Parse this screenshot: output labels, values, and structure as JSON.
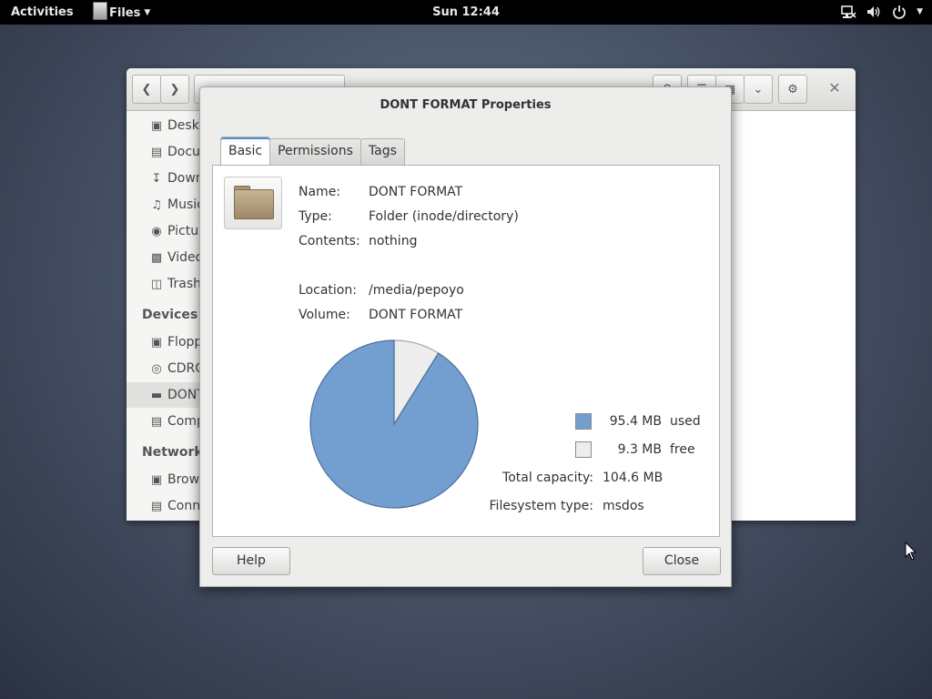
{
  "topbar": {
    "activities": "Activities",
    "app_name": "Files",
    "clock": "Sun 12:44"
  },
  "files_window": {
    "sidebar": {
      "items": [
        {
          "label": "Deskt",
          "icon": "folder-icon"
        },
        {
          "label": "Docu",
          "icon": "document-icon"
        },
        {
          "label": "Down",
          "icon": "download-icon"
        },
        {
          "label": "Music",
          "icon": "music-icon"
        },
        {
          "label": "Pictur",
          "icon": "camera-icon"
        },
        {
          "label": "Video",
          "icon": "film-icon"
        },
        {
          "label": "Trash",
          "icon": "trash-icon"
        }
      ],
      "devices_heading": "Devices",
      "devices": [
        {
          "label": "Flopp",
          "icon": "floppy-icon"
        },
        {
          "label": "CDRO",
          "icon": "optical-disc-icon"
        },
        {
          "label": "DONT",
          "icon": "drive-icon"
        },
        {
          "label": "Comp",
          "icon": "computer-icon"
        }
      ],
      "network_heading": "Network",
      "network": [
        {
          "label": "Brow",
          "icon": "network-icon"
        },
        {
          "label": "Conn",
          "icon": "server-icon"
        }
      ]
    }
  },
  "dialog": {
    "title": "DONT FORMAT Properties",
    "tabs": [
      "Basic",
      "Permissions",
      "Tags"
    ],
    "active_tab": "Basic",
    "fields": {
      "name_label": "Name:",
      "name_value": "DONT FORMAT",
      "type_label": "Type:",
      "type_value": "Folder (inode/directory)",
      "contents_label": "Contents:",
      "contents_value": "nothing",
      "location_label": "Location:",
      "location_value": "/media/pepoyo",
      "volume_label": "Volume:",
      "volume_value": "DONT FORMAT"
    },
    "usage": {
      "used_value": "95.4 MB",
      "used_label": "used",
      "free_value": "9.3 MB",
      "free_label": "free",
      "capacity_label": "Total capacity:",
      "capacity_value": "104.6 MB",
      "fs_label": "Filesystem type:",
      "fs_value": "msdos"
    },
    "help_button": "Help",
    "close_button": "Close"
  },
  "chart_data": {
    "type": "pie",
    "categories": [
      "used",
      "free"
    ],
    "values": [
      95.4,
      9.3
    ],
    "colors": [
      "#729fcf",
      "#ededed"
    ]
  }
}
